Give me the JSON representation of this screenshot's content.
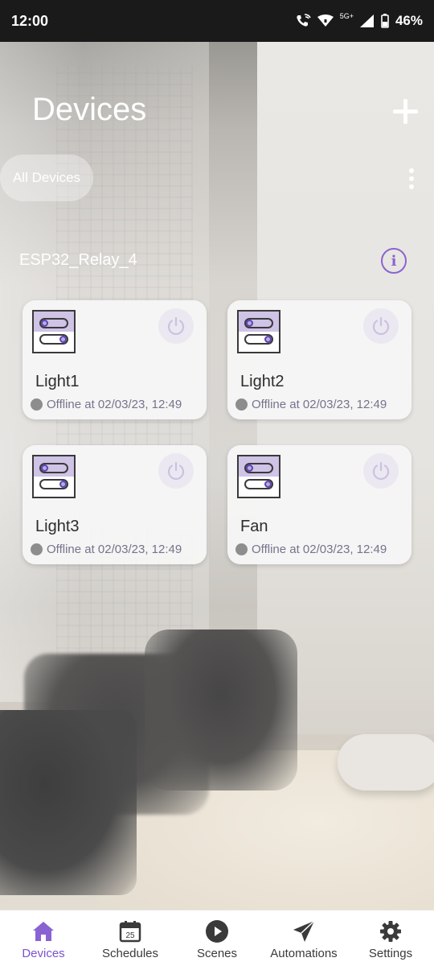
{
  "status_bar": {
    "time": "12:00",
    "network": "5G+",
    "battery": "46%"
  },
  "header": {
    "title": "Devices",
    "add_icon": "plus-icon"
  },
  "filter": {
    "chip_label": "All Devices",
    "more_icon": "more-vert-icon"
  },
  "group": {
    "name": "ESP32_Relay_4",
    "info_icon": "info-icon"
  },
  "devices": [
    {
      "name": "Light1",
      "status": "Offline at 02/03/23, 12:49"
    },
    {
      "name": "Light2",
      "status": "Offline at 02/03/23, 12:49"
    },
    {
      "name": "Light3",
      "status": "Offline at 02/03/23, 12:49"
    },
    {
      "name": "Fan",
      "status": "Offline at 02/03/23, 12:49"
    }
  ],
  "bottom_nav": {
    "items": [
      {
        "label": "Devices",
        "icon": "home-icon",
        "active": true
      },
      {
        "label": "Schedules",
        "icon": "calendar-icon",
        "calendar_day": "25",
        "active": false
      },
      {
        "label": "Scenes",
        "icon": "play-icon",
        "active": false
      },
      {
        "label": "Automations",
        "icon": "send-icon",
        "active": false
      },
      {
        "label": "Settings",
        "icon": "gear-icon",
        "active": false
      }
    ]
  },
  "colors": {
    "accent": "#7a52cc",
    "status_bar": "#1a1a1a",
    "offline_dot": "#8d8d8d"
  }
}
